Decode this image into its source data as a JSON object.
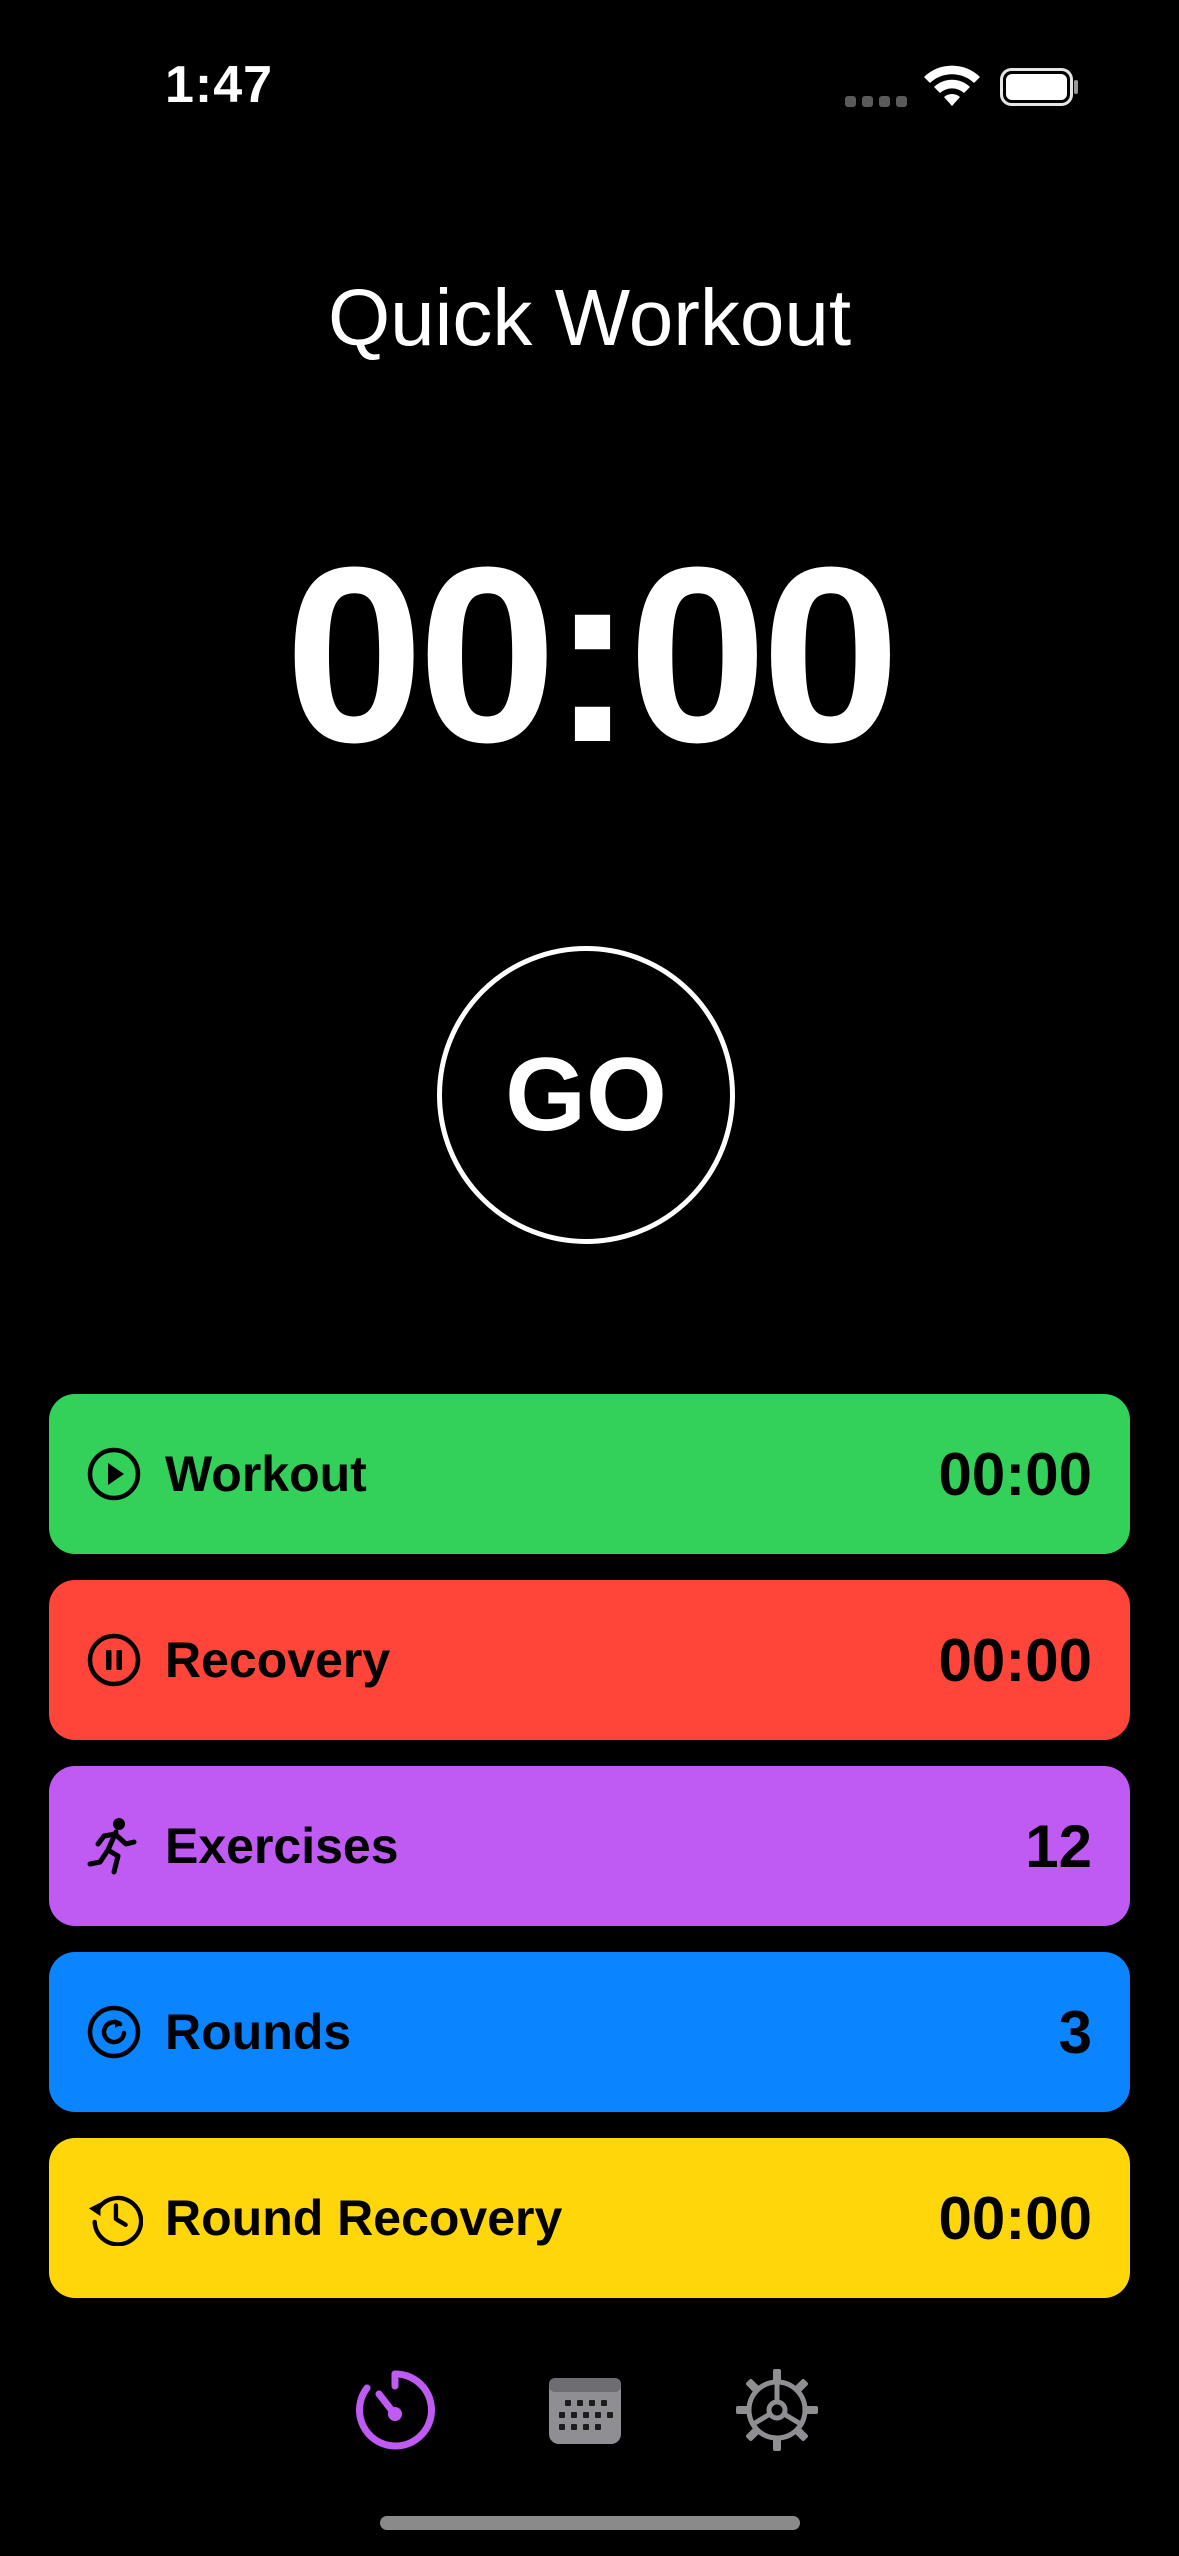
{
  "status_bar": {
    "time": "1:47"
  },
  "title": "Quick Workout",
  "timer": "00:00",
  "go_button": "GO",
  "rows": [
    {
      "label": "Workout",
      "value": "00:00",
      "color": "#33D15A",
      "icon": "play-circle-icon"
    },
    {
      "label": "Recovery",
      "value": "00:00",
      "color": "#FF453A",
      "icon": "pause-circle-icon"
    },
    {
      "label": "Exercises",
      "value": "12",
      "color": "#BF5AF2",
      "icon": "running-figure-icon"
    },
    {
      "label": "Rounds",
      "value": "3",
      "color": "#0A84FF",
      "icon": "repeat-circle-icon"
    },
    {
      "label": "Round Recovery",
      "value": "00:00",
      "color": "#FFD60A",
      "icon": "clock-history-icon"
    }
  ],
  "tab_bar": {
    "tabs": [
      {
        "name": "timer",
        "icon": "timer-icon",
        "active": true,
        "color": "#BF5AF2"
      },
      {
        "name": "calendar",
        "icon": "calendar-icon",
        "active": false,
        "color": "#8E8E93"
      },
      {
        "name": "settings",
        "icon": "gear-icon",
        "active": false,
        "color": "#8E8E93"
      }
    ]
  }
}
